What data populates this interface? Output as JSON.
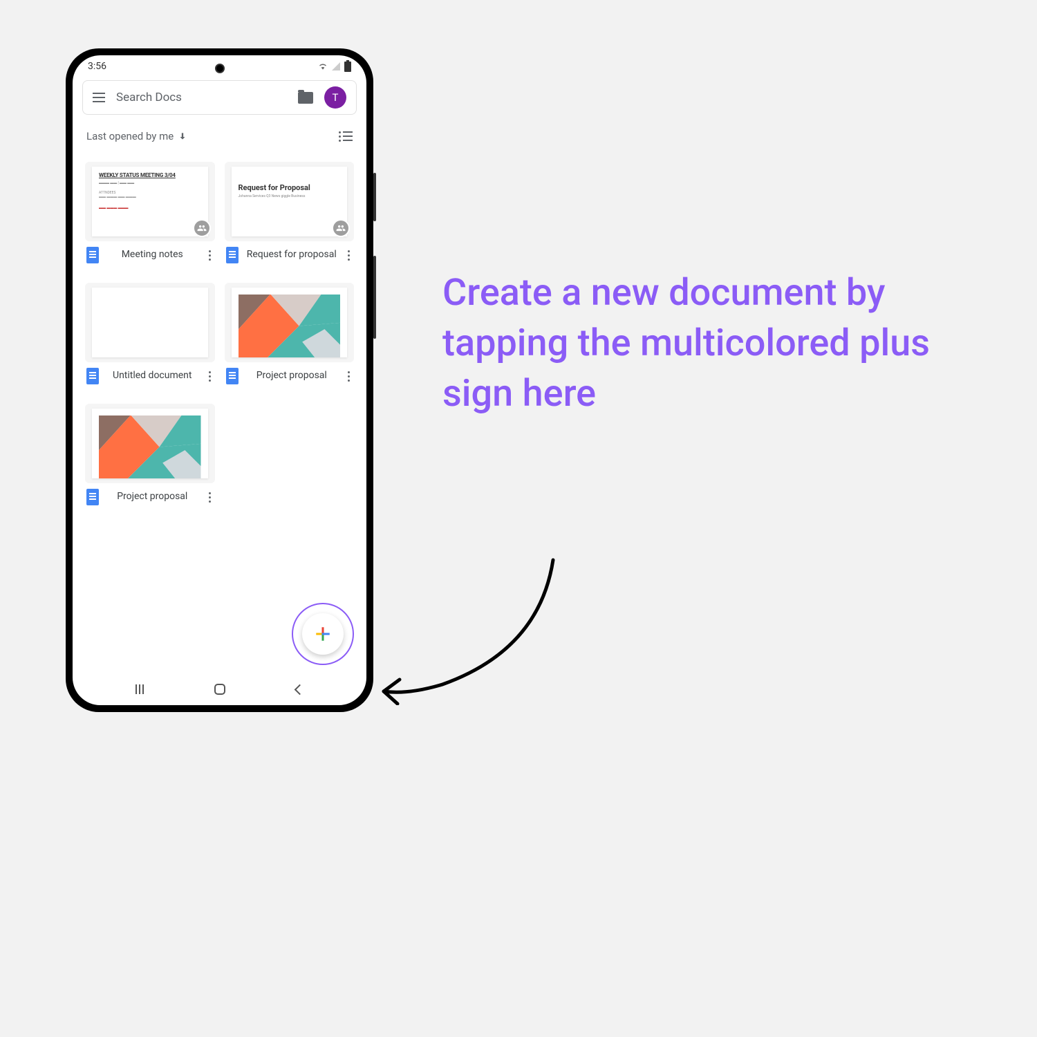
{
  "statusbar": {
    "time": "3:56"
  },
  "search": {
    "placeholder": "Search Docs",
    "avatar_initial": "T"
  },
  "filter": {
    "sort_label": "Last opened by me"
  },
  "docs": [
    {
      "title": "Meeting notes",
      "thumb_type": "meeting",
      "shared": true
    },
    {
      "title": "Request for proposal",
      "thumb_type": "request",
      "shared": true
    },
    {
      "title": "Untitled document",
      "thumb_type": "blank",
      "shared": false
    },
    {
      "title": "Project proposal",
      "thumb_type": "geometric",
      "shared": false
    },
    {
      "title": "Project proposal",
      "thumb_type": "geometric",
      "shared": false
    }
  ],
  "thumb_content": {
    "meeting_title": "WEEKLY STATUS MEETING 3/04",
    "request_title": "Request for Proposal",
    "request_sub": "Johanna Services Q3 News giggle Business"
  },
  "annotation": {
    "text": "Create a new document by tapping the multicolored plus sign here"
  },
  "colors": {
    "accent": "#8b5cf6",
    "avatar": "#7b1fa2",
    "docs_icon": "#4285f4"
  }
}
